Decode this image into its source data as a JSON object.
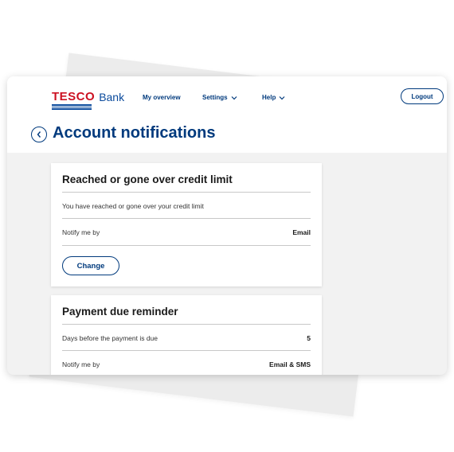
{
  "brand": {
    "name": "TESCO",
    "product": "Bank"
  },
  "nav": {
    "overview": "My overview",
    "settings": "Settings",
    "help": "Help",
    "logout": "Logout"
  },
  "page": {
    "title": "Account notifications"
  },
  "cards": [
    {
      "title": "Reached or gone over credit limit",
      "rows": [
        {
          "label": "You have reached or gone over your credit limit",
          "value": ""
        },
        {
          "label": "Notify me by",
          "value": "Email"
        }
      ],
      "button": "Change"
    },
    {
      "title": "Payment due reminder",
      "rows": [
        {
          "label": "Days before the payment is due",
          "value": "5"
        },
        {
          "label": "Notify me by",
          "value": "Email & SMS"
        }
      ]
    }
  ],
  "colors": {
    "brand_blue": "#003a7d",
    "brand_red": "#cc1122",
    "background": "#f2f2f2"
  }
}
